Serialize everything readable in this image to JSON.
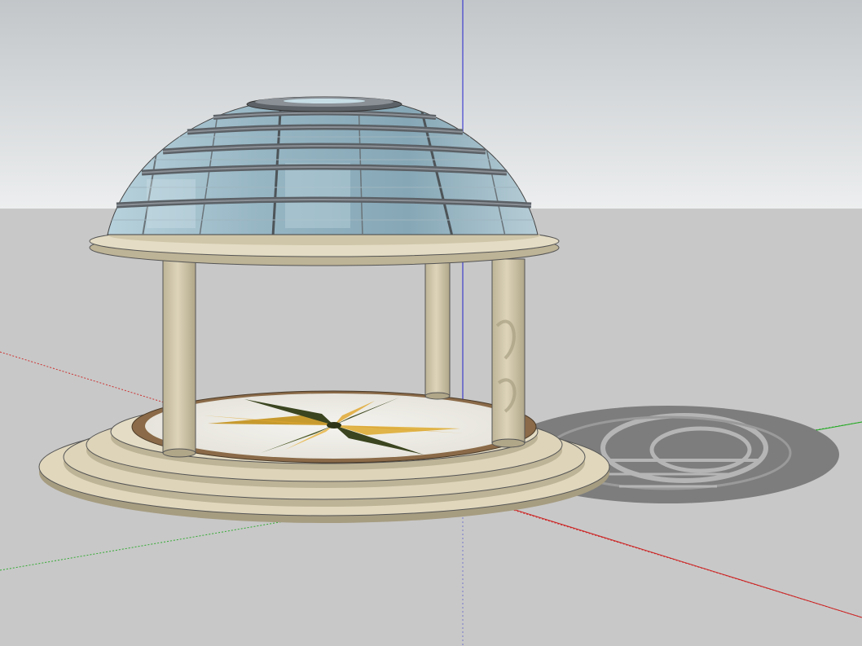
{
  "app": {
    "type": "3d-modeling-viewport"
  },
  "scene": {
    "model": "domed-gazebo",
    "colors": {
      "sky_top": "#c2c6c9",
      "sky_bottom": "#eceeef",
      "ground": "#c8c8c8",
      "stone": "#d8ceb2",
      "stone_shade": "#bdb396",
      "stone_dark": "#a69c80",
      "glass": "#8fb0c0",
      "glass_light": "#c7dde6",
      "mullion": "#5b6166",
      "shadow": "#7d7d7d",
      "floor_ring": "#8a6a48",
      "compass_yellow": "#e0a832",
      "compass_dark": "#3f4a22",
      "axis_red": "#cc2222",
      "axis_green": "#22aa22",
      "axis_blue": "#2222cc"
    }
  }
}
